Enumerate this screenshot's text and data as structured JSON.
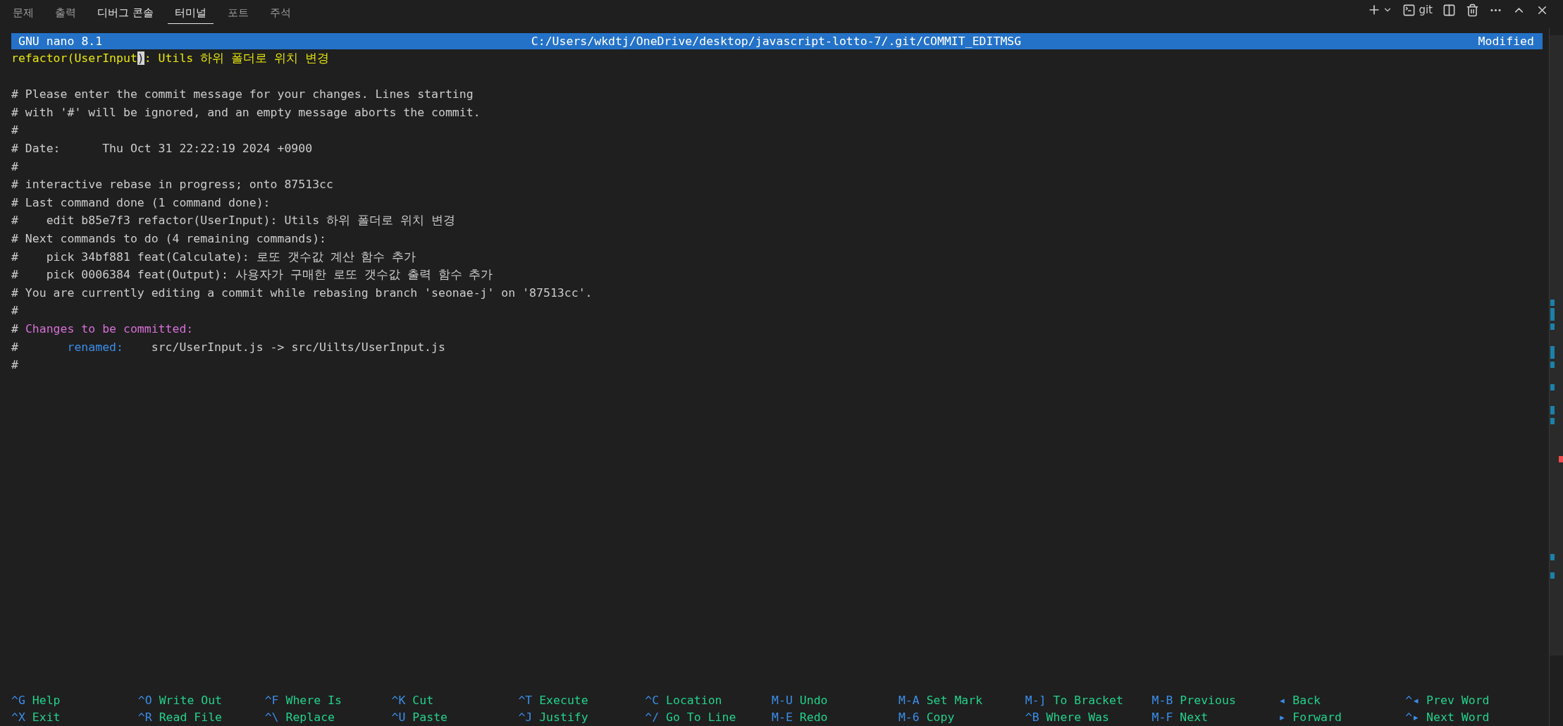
{
  "panel_tabs": [
    {
      "label": "문제",
      "selected": false,
      "hovered": false
    },
    {
      "label": "출력",
      "selected": false,
      "hovered": false
    },
    {
      "label": "디버그 콘솔",
      "selected": false,
      "hovered": true
    },
    {
      "label": "터미널",
      "selected": true,
      "hovered": false
    },
    {
      "label": "포트",
      "selected": false,
      "hovered": false
    },
    {
      "label": "주석",
      "selected": false,
      "hovered": false
    }
  ],
  "toolbar": {
    "terminal_name": "git"
  },
  "nano_header": {
    "version": "GNU nano 8.1",
    "file_path": "C:/Users/wkdtj/OneDrive/desktop/javascript-lotto-7/.git/COMMIT_EDITMSG",
    "status": "Modified"
  },
  "lines": [
    {
      "kind": "text",
      "segments": [
        {
          "kind": "message",
          "text": "refactor(UserInput"
        },
        {
          "kind": "cursor",
          "text": ")"
        },
        {
          "kind": "message",
          "text": ": Utils 하위 폴더로 위치 변경"
        }
      ]
    },
    {
      "kind": "blank"
    },
    {
      "kind": "text",
      "segments": [
        {
          "kind": "comment",
          "text": "# Please enter the commit message for your changes. Lines starting"
        }
      ]
    },
    {
      "kind": "text",
      "segments": [
        {
          "kind": "comment",
          "text": "# with '#' will be ignored, and an empty message aborts the commit."
        }
      ]
    },
    {
      "kind": "text",
      "segments": [
        {
          "kind": "comment",
          "text": "#"
        }
      ]
    },
    {
      "kind": "text",
      "segments": [
        {
          "kind": "comment",
          "text": "# Date:      Thu Oct 31 22:22:19 2024 +0900"
        }
      ]
    },
    {
      "kind": "text",
      "segments": [
        {
          "kind": "comment",
          "text": "#"
        }
      ]
    },
    {
      "kind": "text",
      "segments": [
        {
          "kind": "comment",
          "text": "# interactive rebase in progress; onto 87513cc"
        }
      ]
    },
    {
      "kind": "text",
      "segments": [
        {
          "kind": "comment",
          "text": "# Last command done (1 command done):"
        }
      ]
    },
    {
      "kind": "text",
      "segments": [
        {
          "kind": "comment",
          "text": "#    edit b85e7f3 refactor(UserInput): Utils 하위 폴더로 위치 변경"
        }
      ]
    },
    {
      "kind": "text",
      "segments": [
        {
          "kind": "comment",
          "text": "# Next commands to do (4 remaining commands):"
        }
      ]
    },
    {
      "kind": "text",
      "segments": [
        {
          "kind": "comment",
          "text": "#    pick 34bf881 feat(Calculate): 로또 갯수값 계산 함수 추가"
        }
      ]
    },
    {
      "kind": "text",
      "segments": [
        {
          "kind": "comment",
          "text": "#    pick 0006384 feat(Output): 사용자가 구매한 로또 갯수값 출력 함수 추가"
        }
      ]
    },
    {
      "kind": "text",
      "segments": [
        {
          "kind": "comment",
          "text": "# You are currently editing a commit while rebasing branch 'seonae-j' on '87513cc'."
        }
      ]
    },
    {
      "kind": "text",
      "segments": [
        {
          "kind": "comment",
          "text": "#"
        }
      ]
    },
    {
      "kind": "text",
      "segments": [
        {
          "kind": "comment",
          "text": "# "
        },
        {
          "kind": "heading",
          "text": "Changes to be committed:"
        }
      ]
    },
    {
      "kind": "text",
      "segments": [
        {
          "kind": "comment",
          "text": "#       "
        },
        {
          "kind": "keyword",
          "text": "renamed:"
        },
        {
          "kind": "comment",
          "text": "    src/UserInput.js -> src/Uilts/UserInput.js"
        }
      ]
    },
    {
      "kind": "text",
      "segments": [
        {
          "kind": "comment",
          "text": "#"
        }
      ]
    }
  ],
  "shortcuts": [
    [
      {
        "key": "^G",
        "label": "Help"
      },
      {
        "key": "^O",
        "label": "Write Out"
      },
      {
        "key": "^F",
        "label": "Where Is"
      },
      {
        "key": "^K",
        "label": "Cut"
      },
      {
        "key": "^T",
        "label": "Execute"
      },
      {
        "key": "^C",
        "label": "Location"
      },
      {
        "key": "M-U",
        "label": "Undo"
      },
      {
        "key": "M-A",
        "label": "Set Mark"
      },
      {
        "key": "M-]",
        "label": "To Bracket"
      },
      {
        "key": "M-B",
        "label": "Previous"
      },
      {
        "key": "◂",
        "label": "Back"
      },
      {
        "key": "^◂",
        "label": "Prev Word"
      }
    ],
    [
      {
        "key": "^X",
        "label": "Exit"
      },
      {
        "key": "^R",
        "label": "Read File"
      },
      {
        "key": "^\\",
        "label": "Replace"
      },
      {
        "key": "^U",
        "label": "Paste"
      },
      {
        "key": "^J",
        "label": "Justify"
      },
      {
        "key": "^/",
        "label": "Go To Line"
      },
      {
        "key": "M-E",
        "label": "Redo"
      },
      {
        "key": "M-6",
        "label": "Copy"
      },
      {
        "key": "^B",
        "label": "Where Was"
      },
      {
        "key": "M-F",
        "label": "Next"
      },
      {
        "key": "▸",
        "label": "Forward"
      },
      {
        "key": "^▸",
        "label": "Next Word"
      }
    ]
  ]
}
